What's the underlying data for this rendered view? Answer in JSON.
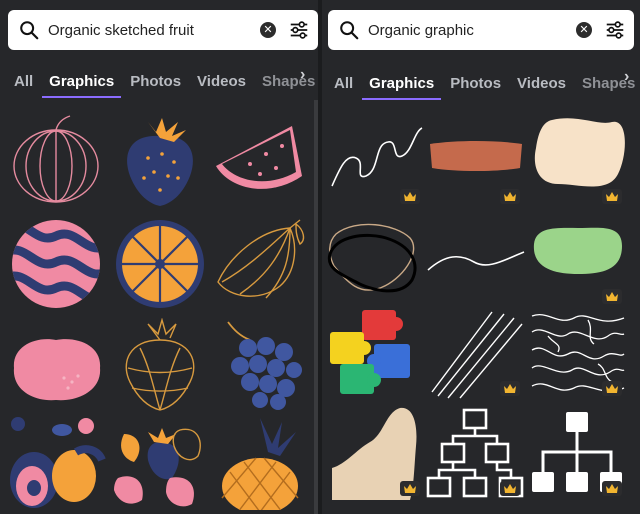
{
  "left_panel": {
    "search": {
      "value": "Organic sketched fruit",
      "placeholder": "Search"
    },
    "tabs": [
      {
        "label": "All",
        "active": false
      },
      {
        "label": "Graphics",
        "active": true
      },
      {
        "label": "Photos",
        "active": false
      },
      {
        "label": "Videos",
        "active": false
      },
      {
        "label": "Shapes",
        "active": false
      }
    ],
    "more_tabs_glyph": "›",
    "grid": [
      {
        "name": "sketched-onion-outline",
        "premium": false
      },
      {
        "name": "navy-strawberry",
        "premium": false
      },
      {
        "name": "watermelon-slice",
        "premium": false
      },
      {
        "name": "striped-watermelon",
        "premium": false
      },
      {
        "name": "orange-slice",
        "premium": false
      },
      {
        "name": "sketched-pear-outline",
        "premium": false
      },
      {
        "name": "pink-pomegranate",
        "premium": false
      },
      {
        "name": "sketched-strawberry-outline",
        "premium": false
      },
      {
        "name": "grape-bunch",
        "premium": false
      },
      {
        "name": "fruit-collage",
        "premium": false
      },
      {
        "name": "strawberries-group",
        "premium": false
      },
      {
        "name": "pineapple",
        "premium": false
      }
    ]
  },
  "right_panel": {
    "search": {
      "value": "Organic graphic",
      "placeholder": "Search"
    },
    "tabs": [
      {
        "label": "All",
        "active": false
      },
      {
        "label": "Graphics",
        "active": true
      },
      {
        "label": "Photos",
        "active": false
      },
      {
        "label": "Videos",
        "active": false
      },
      {
        "label": "Shapes",
        "active": false
      }
    ],
    "more_tabs_glyph": "›",
    "grid": [
      {
        "name": "white-squiggle-line",
        "premium": true
      },
      {
        "name": "rust-brush-stroke",
        "premium": true
      },
      {
        "name": "cream-organic-blob",
        "premium": true
      },
      {
        "name": "outline-blob-shapes",
        "premium": false
      },
      {
        "name": "white-wavy-line",
        "premium": false
      },
      {
        "name": "green-rounded-blob",
        "premium": true
      },
      {
        "name": "colorful-puzzle-pieces",
        "premium": false
      },
      {
        "name": "white-diagonal-lines",
        "premium": true
      },
      {
        "name": "topographic-pattern",
        "premium": true
      },
      {
        "name": "beige-organic-shape",
        "premium": true
      },
      {
        "name": "flowchart-outline",
        "premium": true
      },
      {
        "name": "flowchart-solid",
        "premium": true
      }
    ]
  },
  "colors": {
    "background": "#26272a",
    "accent_underline": "#8b6cff",
    "navy": "#2f3c72",
    "pink": "#f08aa3",
    "orange": "#f4a23a",
    "sketch_stroke": "#e58b9f",
    "gold_stroke": "#d79a3f",
    "crown": "#f2b530"
  }
}
